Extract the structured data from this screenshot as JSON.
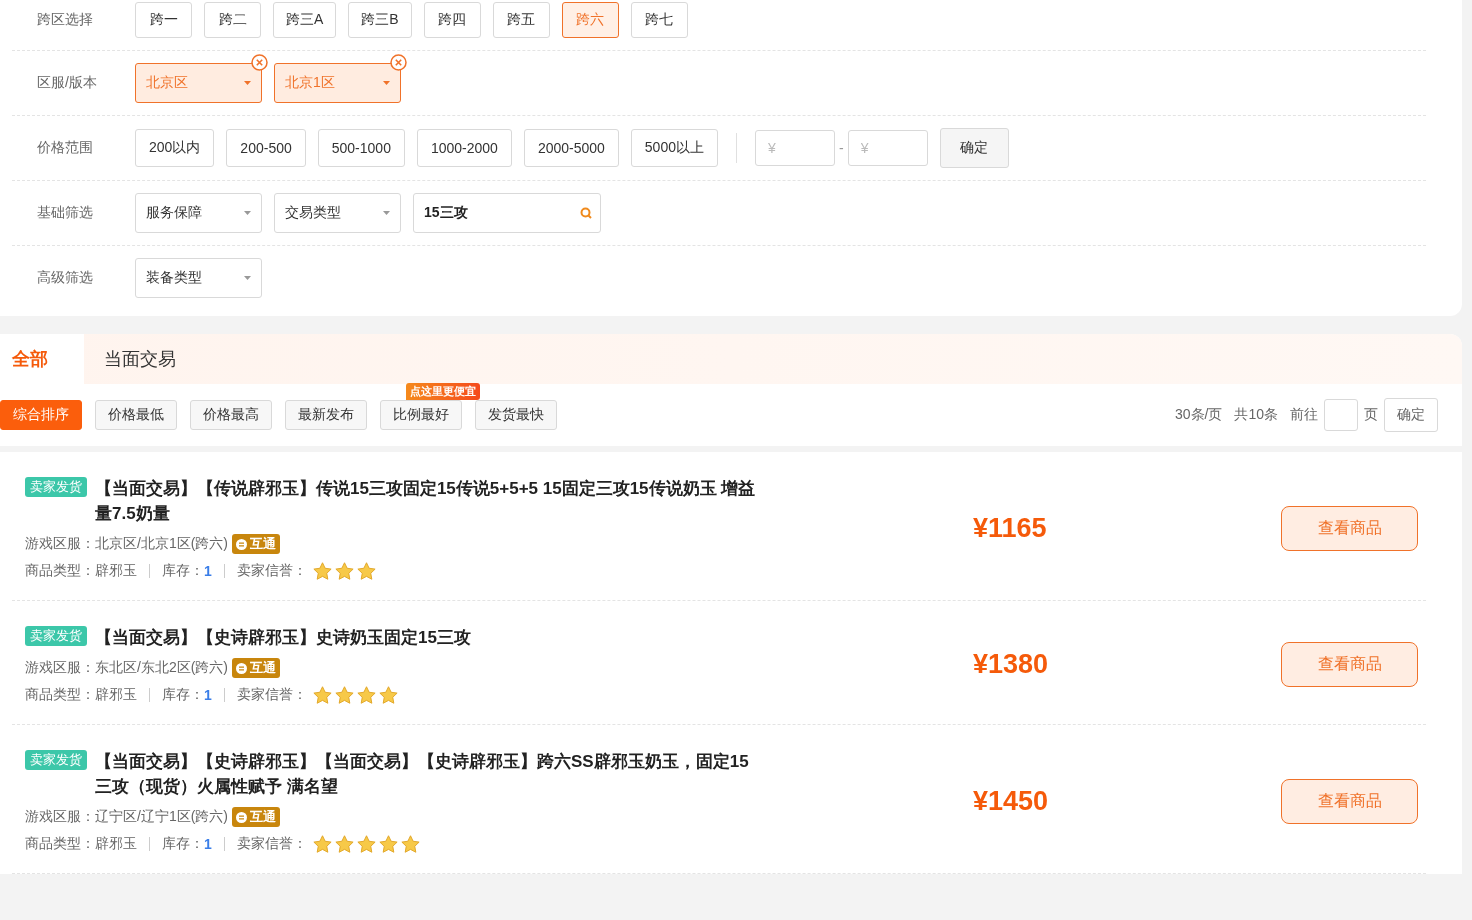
{
  "filters": {
    "region": {
      "label": "跨区选择",
      "options": [
        {
          "label": "跨一",
          "selected": false
        },
        {
          "label": "跨二",
          "selected": false
        },
        {
          "label": "跨三A",
          "selected": false
        },
        {
          "label": "跨三B",
          "selected": false
        },
        {
          "label": "跨四",
          "selected": false
        },
        {
          "label": "跨五",
          "selected": false
        },
        {
          "label": "跨六",
          "selected": true
        },
        {
          "label": "跨七",
          "selected": false
        }
      ]
    },
    "server": {
      "label": "区服/版本",
      "selects": [
        {
          "value": "北京区",
          "active": true
        },
        {
          "value": "北京1区",
          "active": true
        }
      ]
    },
    "price": {
      "label": "价格范围",
      "options": [
        "200以内",
        "200-500",
        "500-1000",
        "1000-2000",
        "2000-5000",
        "5000以上"
      ],
      "min_placeholder": "¥",
      "separator": "-",
      "max_placeholder": "¥",
      "confirm": "确定"
    },
    "basic": {
      "label": "基础筛选",
      "selects": [
        {
          "value": "服务保障",
          "active": false
        },
        {
          "value": "交易类型",
          "active": false
        }
      ],
      "search": {
        "value": "15三攻"
      }
    },
    "advanced": {
      "label": "高级筛选",
      "selects": [
        {
          "value": "装备类型",
          "active": false
        }
      ]
    }
  },
  "category_tabs": [
    {
      "label": "全部",
      "selected": true
    },
    {
      "label": "当面交易",
      "selected": false
    }
  ],
  "sort_buttons": [
    {
      "label": "综合排序",
      "selected": true
    },
    {
      "label": "价格最低",
      "selected": false
    },
    {
      "label": "价格最高",
      "selected": false
    },
    {
      "label": "最新发布",
      "selected": false
    },
    {
      "label": "比例最好",
      "selected": false,
      "badge": "点这里更便宜"
    },
    {
      "label": "发货最快",
      "selected": false
    }
  ],
  "pagination": {
    "per_page": "30条/页",
    "total": "共10条",
    "goto": "前往",
    "page_unit": "页",
    "confirm": "确定"
  },
  "listings": [
    {
      "tag": "卖家发货",
      "title": "【当面交易】【传说辟邪玉】传说15三攻固定15传说5+5+5 15固定三攻15传说奶玉 增益量7.5奶量",
      "server_label": "游戏区服：",
      "server": "北京区/北京1区(跨六)",
      "interop": "互通",
      "type_label": "商品类型：",
      "type": "辟邪玉",
      "stock_label": "库存：",
      "stock": "1",
      "credit_label": "卖家信誉：",
      "stars": 3,
      "price": "¥1165",
      "button": "查看商品"
    },
    {
      "tag": "卖家发货",
      "title": "【当面交易】【史诗辟邪玉】史诗奶玉固定15三攻",
      "server_label": "游戏区服：",
      "server": "东北区/东北2区(跨六)",
      "interop": "互通",
      "type_label": "商品类型：",
      "type": "辟邪玉",
      "stock_label": "库存：",
      "stock": "1",
      "credit_label": "卖家信誉：",
      "stars": 4,
      "price": "¥1380",
      "button": "查看商品"
    },
    {
      "tag": "卖家发货",
      "title": "【当面交易】【史诗辟邪玉】【当面交易】【史诗辟邪玉】跨六SS辟邪玉奶玉，固定15三攻（现货）火属性赋予 满名望",
      "server_label": "游戏区服：",
      "server": "辽宁区/辽宁1区(跨六)",
      "interop": "互通",
      "type_label": "商品类型：",
      "type": "辟邪玉",
      "stock_label": "库存：",
      "stock": "1",
      "credit_label": "卖家信誉：",
      "stars": 5,
      "price": "¥1450",
      "button": "查看商品"
    }
  ]
}
